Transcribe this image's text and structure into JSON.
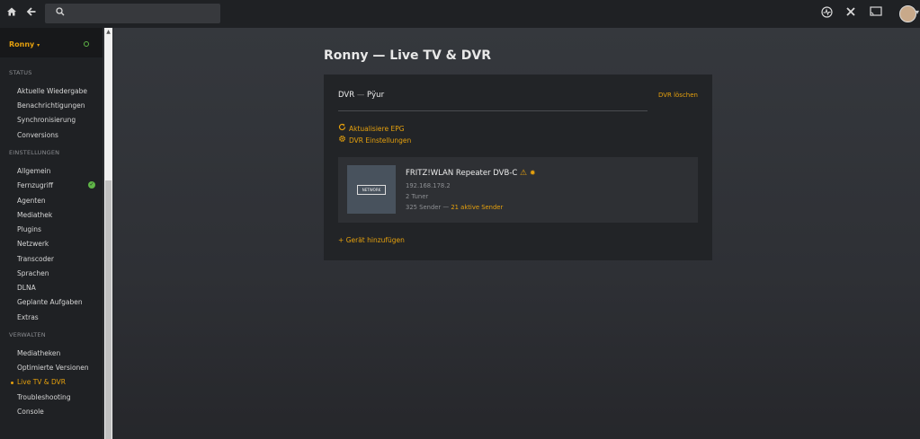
{
  "topbar": {
    "home_icon": "home-icon",
    "back_icon": "back-arrow-icon",
    "search_icon": "search-icon",
    "search_placeholder": "",
    "activity_icon": "activity-icon",
    "settings_icon": "tools-icon",
    "cast_icon": "cast-icon",
    "avatar_icon": "avatar"
  },
  "sidebar": {
    "user": "Ronny",
    "sections": [
      {
        "title": "STATUS",
        "items": [
          "Aktuelle Wiedergabe",
          "Benachrichtigungen",
          "Synchronisierung",
          "Conversions"
        ]
      },
      {
        "title": "EINSTELLUNGEN",
        "items": [
          "Allgemein",
          "Fernzugriff",
          "Agenten",
          "Mediathek",
          "Plugins",
          "Netzwerk",
          "Transcoder",
          "Sprachen",
          "DLNA",
          "Geplante Aufgaben",
          "Extras"
        ]
      },
      {
        "title": "VERWALTEN",
        "items": [
          "Mediatheken",
          "Optimierte Versionen",
          "Live TV & DVR",
          "Troubleshooting",
          "Console"
        ]
      }
    ],
    "active_item": "Live TV & DVR",
    "accent_color": "#e5a00d"
  },
  "main": {
    "title": "Ronny — Live TV & DVR",
    "dvr": {
      "label": "DVR",
      "separator": "—",
      "provider": "Pÿur",
      "delete_label": "DVR löschen",
      "actions": [
        "Aktualisiere EPG",
        "DVR Einstellungen"
      ],
      "device": {
        "thumb_label": "NETWORK",
        "name": "FRITZ!WLAN Repeater DVB-C",
        "ip": "192.168.178.2",
        "tuners": "2 Tuner",
        "channels": "325 Sender —",
        "active_channels": "21 aktive Sender"
      },
      "add_device_label": "Gerät hinzufügen"
    }
  }
}
